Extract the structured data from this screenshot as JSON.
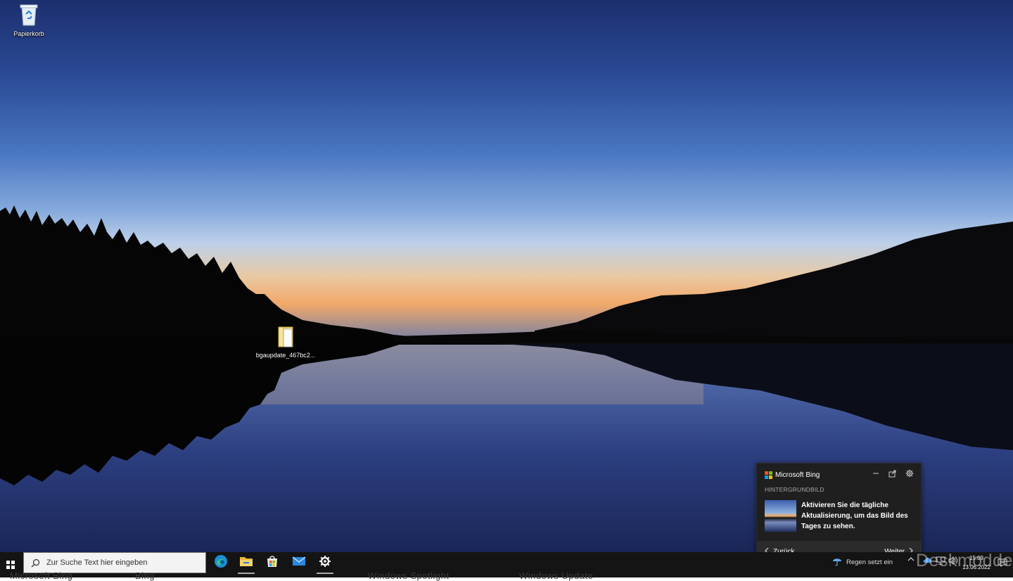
{
  "desktop": {
    "icons": [
      {
        "label": "Papierkorb",
        "icon": "recycle-bin-icon"
      },
      {
        "label": "bgaupdate_467bc2...",
        "icon": "folder-icon"
      }
    ]
  },
  "bing_popup": {
    "brand": "Microsoft Bing",
    "section": "HINTERGRUNDBILD",
    "message": "Aktivieren Sie die tägliche Aktualisierung, um das Bild des Tages zu sehen.",
    "back_label": "Zurück",
    "next_label": "Weiter",
    "controls": [
      "minimize-icon",
      "share-icon",
      "settings-gear-icon"
    ]
  },
  "taskbar": {
    "search_placeholder": "Zur Suche Text hier eingeben",
    "apps": [
      "edge-icon",
      "file-explorer-icon",
      "microsoft-store-icon",
      "mail-icon",
      "settings-gear-icon"
    ],
    "weather_text": "Regen setzt ein",
    "clock_time": "15:09",
    "clock_date": "13.06.2022",
    "ghost_labels": [
      "Microsoft Bing",
      "Bing",
      "Windows Spotlight",
      "Windows Update"
    ]
  },
  "watermark": "Deskmodder.de"
}
